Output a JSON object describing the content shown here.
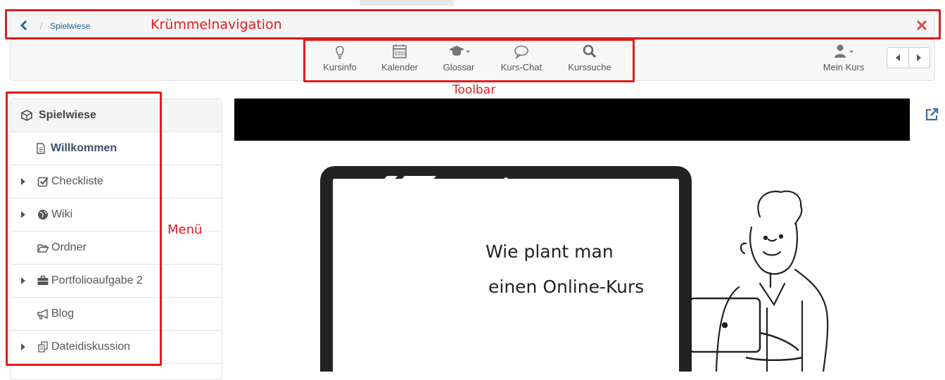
{
  "breadcrumb": {
    "items": [
      "Spielwiese"
    ],
    "separator": "/"
  },
  "toolbar": {
    "tools": [
      {
        "label": "Kursinfo",
        "icon": "lightbulb-icon"
      },
      {
        "label": "Kalender",
        "icon": "calendar-icon"
      },
      {
        "label": "Glossar",
        "icon": "graduation-cap-icon"
      },
      {
        "label": "Kurs-Chat",
        "icon": "chat-bubble-icon"
      },
      {
        "label": "Kurssuche",
        "icon": "search-icon"
      }
    ],
    "user_label": "Mein Kurs"
  },
  "annotations": {
    "breadcrumb": "Krümmelnavigation",
    "toolbar": "Toolbar",
    "menu": "Menü"
  },
  "menu": {
    "items": [
      {
        "label": "Spielwiese",
        "icon": "cube-icon",
        "root": true,
        "expandable": false
      },
      {
        "label": "Willkommen",
        "icon": "document-icon",
        "active": true,
        "expandable": false
      },
      {
        "label": "Checkliste",
        "icon": "checkbox-icon",
        "expandable": true
      },
      {
        "label": "Wiki",
        "icon": "globe-icon",
        "expandable": true
      },
      {
        "label": "Ordner",
        "icon": "folder-open-icon",
        "expandable": false
      },
      {
        "label": "Portfolioaufgabe 2",
        "icon": "briefcase-icon",
        "expandable": true
      },
      {
        "label": "Blog",
        "icon": "megaphone-icon",
        "expandable": false
      },
      {
        "label": "Dateidiskussion",
        "icon": "files-icon",
        "expandable": true
      }
    ]
  },
  "content": {
    "video_text_line1": "Wie plant man",
    "video_text_line2": "einen Online-Kurs"
  },
  "colors": {
    "annotation": "#e51b1b",
    "link": "#2a6496",
    "close": "#d9534f"
  }
}
